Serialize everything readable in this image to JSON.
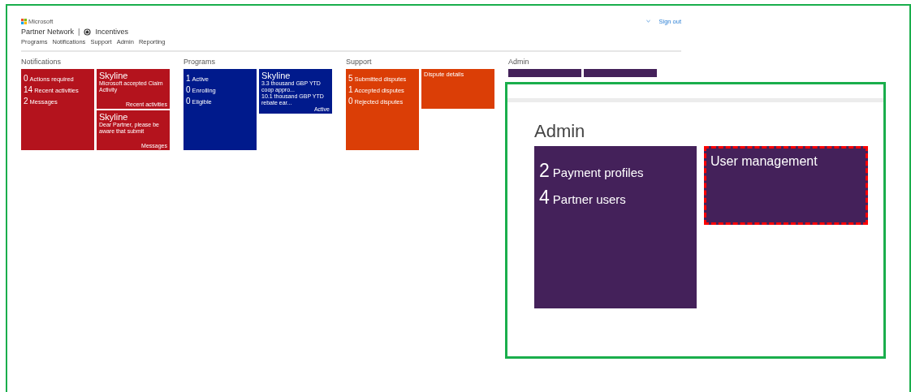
{
  "header": {
    "brand": "Microsoft",
    "site": "Partner Network",
    "separator": "|",
    "product": "Incentives",
    "nav": [
      "Programs",
      "Notifications",
      "Support",
      "Admin",
      "Reporting"
    ],
    "sign_out": "Sign out"
  },
  "sections": [
    {
      "title": "Notifications",
      "color": "#b4131d",
      "summary": [
        {
          "count": "0",
          "label": "Actions required"
        },
        {
          "count": "14",
          "label": "Recent activities"
        },
        {
          "count": "2",
          "label": "Messages"
        }
      ],
      "tiles": [
        {
          "title": "Skyline",
          "text": [
            "Microsoft accepted Claim Activity"
          ],
          "footer": "Recent activities"
        },
        {
          "title": "Skyline",
          "text": [
            "Dear Partner, please be aware that submit"
          ],
          "footer": "Messages"
        }
      ]
    },
    {
      "title": "Programs",
      "color": "#001a8c",
      "summary": [
        {
          "count": "1",
          "label": "Active"
        },
        {
          "count": "0",
          "label": "Enrolling"
        },
        {
          "count": "0",
          "label": "Eligible"
        }
      ],
      "tiles": [
        {
          "title": "Skyline",
          "text": [
            "3.3 thousand GBP YTD coop appro...",
            "10.1 thousand GBP YTD rebate ear..."
          ],
          "footer": "Active"
        }
      ]
    },
    {
      "title": "Support",
      "color": "#db3e06",
      "summary": [
        {
          "count": "5",
          "label": "Submitted disputes"
        },
        {
          "count": "1",
          "label": "Accepted disputes"
        },
        {
          "count": "0",
          "label": "Rejected disputes"
        }
      ],
      "tiles": [
        {
          "title": "Dispute details"
        }
      ]
    }
  ],
  "admin_partial": {
    "title": "Admin",
    "color": "#44215a"
  },
  "zoom_inset": {
    "title": "Admin",
    "color": "#44215a",
    "summary": [
      {
        "count": "2",
        "label": "Payment profiles"
      },
      {
        "count": "4",
        "label": "Partner users"
      }
    ],
    "tiles": [
      {
        "title": "User management",
        "highlighted": true
      }
    ]
  }
}
